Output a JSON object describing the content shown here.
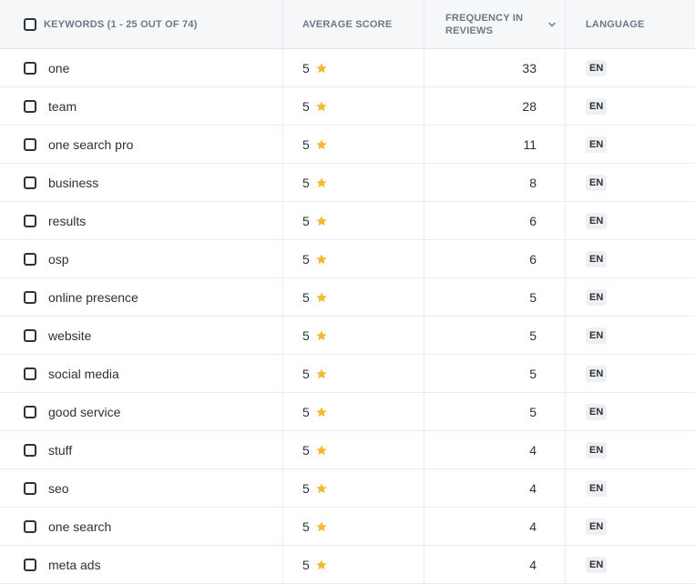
{
  "header": {
    "keywords_label": "KEYWORDS (1 - 25 OUT OF 74)",
    "score_label": "AVERAGE SCORE",
    "frequency_label_line1": "FREQUENCY IN",
    "frequency_label_line2": "REVIEWS",
    "language_label": "LANGUAGE"
  },
  "colors": {
    "star": "#f5b82e",
    "header_bg": "#f6f7f9",
    "header_text": "#6b7a86",
    "badge_bg": "#eef0f3"
  },
  "rows": [
    {
      "keyword": "one",
      "score": "5",
      "frequency": "33",
      "language": "EN"
    },
    {
      "keyword": "team",
      "score": "5",
      "frequency": "28",
      "language": "EN"
    },
    {
      "keyword": "one search pro",
      "score": "5",
      "frequency": "11",
      "language": "EN"
    },
    {
      "keyword": "business",
      "score": "5",
      "frequency": "8",
      "language": "EN"
    },
    {
      "keyword": "results",
      "score": "5",
      "frequency": "6",
      "language": "EN"
    },
    {
      "keyword": "osp",
      "score": "5",
      "frequency": "6",
      "language": "EN"
    },
    {
      "keyword": "online presence",
      "score": "5",
      "frequency": "5",
      "language": "EN"
    },
    {
      "keyword": "website",
      "score": "5",
      "frequency": "5",
      "language": "EN"
    },
    {
      "keyword": "social media",
      "score": "5",
      "frequency": "5",
      "language": "EN"
    },
    {
      "keyword": "good service",
      "score": "5",
      "frequency": "5",
      "language": "EN"
    },
    {
      "keyword": "stuff",
      "score": "5",
      "frequency": "4",
      "language": "EN"
    },
    {
      "keyword": "seo",
      "score": "5",
      "frequency": "4",
      "language": "EN"
    },
    {
      "keyword": "one search",
      "score": "5",
      "frequency": "4",
      "language": "EN"
    },
    {
      "keyword": "meta ads",
      "score": "5",
      "frequency": "4",
      "language": "EN"
    }
  ]
}
